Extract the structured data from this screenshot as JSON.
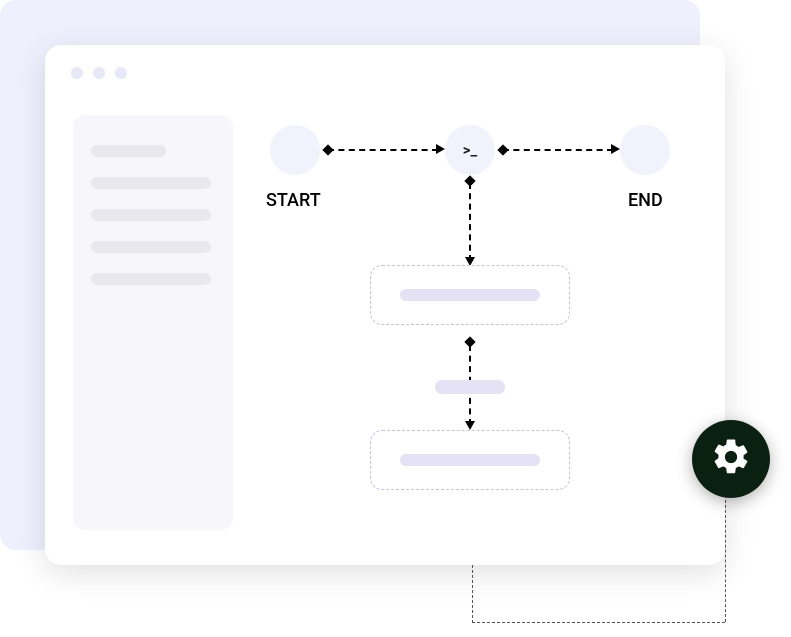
{
  "flow": {
    "start_label": "START",
    "end_label": "END",
    "command_glyph": ">_"
  },
  "sidebar": {
    "lines": [
      "short",
      "long",
      "long",
      "long",
      "long"
    ]
  },
  "settings_button": {
    "icon": "gear-icon"
  }
}
